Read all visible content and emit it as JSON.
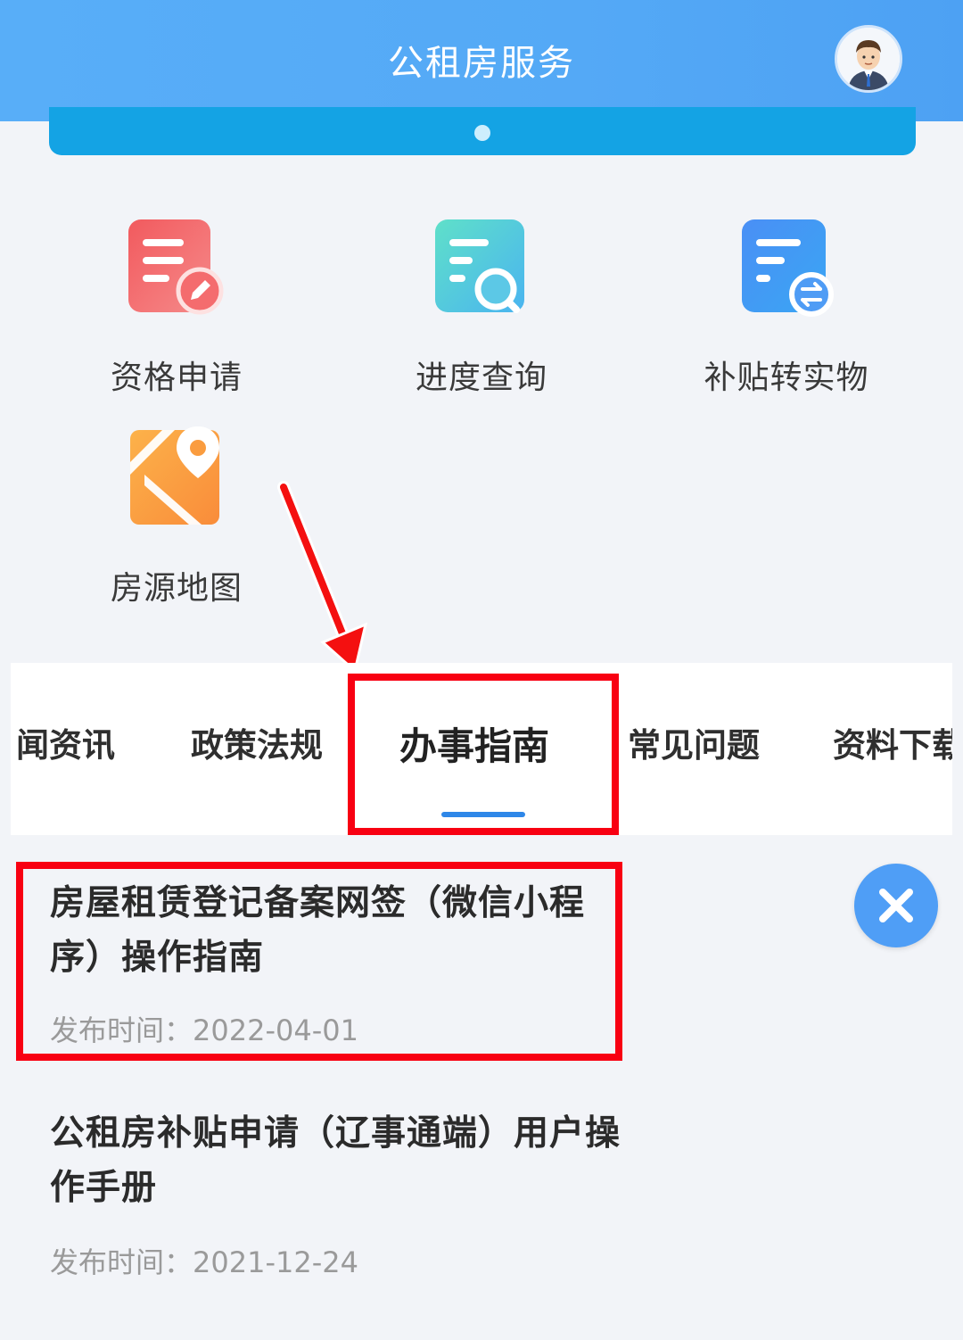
{
  "header": {
    "title": "公租房服务",
    "avatar": "user-avatar-icon"
  },
  "services": [
    {
      "label": "资格申请",
      "icon": "form-edit-icon"
    },
    {
      "label": "进度查询",
      "icon": "document-search-icon"
    },
    {
      "label": "补贴转实物",
      "icon": "document-exchange-icon"
    },
    {
      "label": "房源地图",
      "icon": "map-pin-icon"
    }
  ],
  "tabs": [
    {
      "label": "闻资讯"
    },
    {
      "label": "政策法规"
    },
    {
      "label": "办事指南",
      "active": true
    },
    {
      "label": "常见问题"
    },
    {
      "label": "资料下载"
    }
  ],
  "articles": [
    {
      "title": "房屋租赁登记备案网签（微信小程序）操作指南",
      "date": "发布时间：2022-04-01"
    },
    {
      "title": "公租房补贴申请（辽事通端）用户操作手册",
      "date": "发布时间：2021-12-24"
    }
  ],
  "close_icon": "close-icon",
  "colors": {
    "header": "#58aef8",
    "accent": "#2e87e8",
    "highlight": "#f80012"
  }
}
